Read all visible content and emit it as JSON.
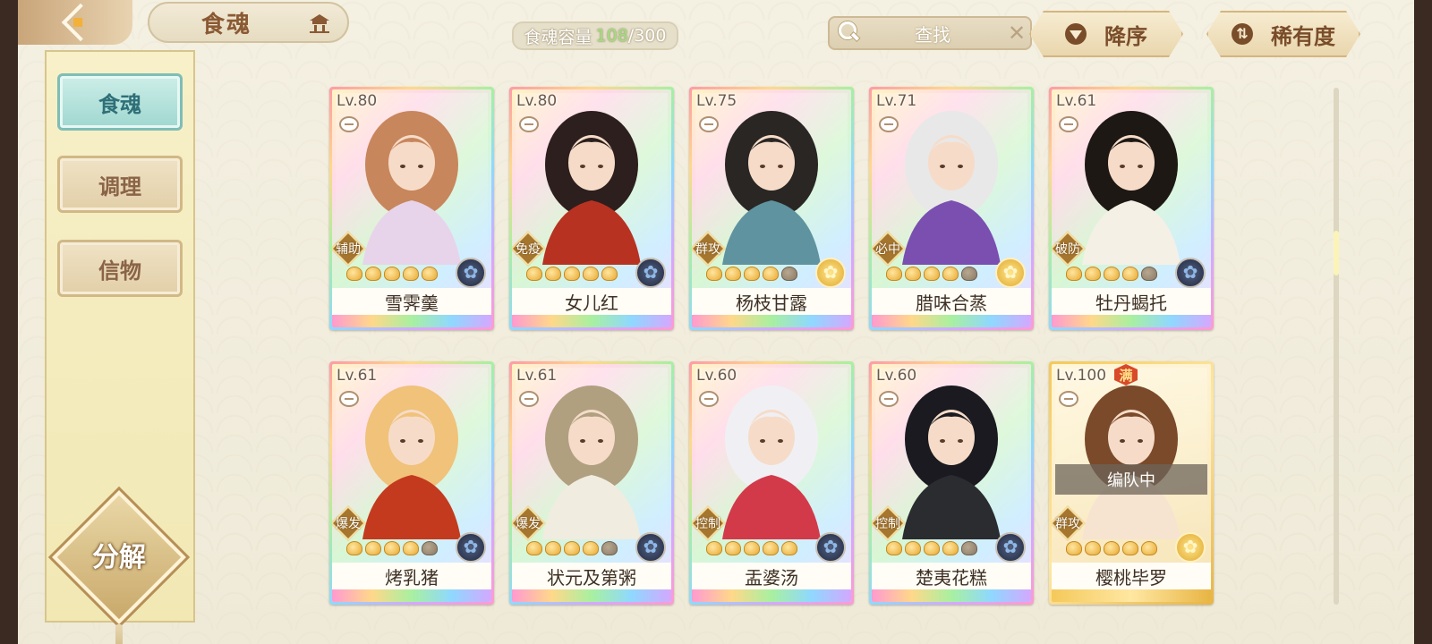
{
  "header": {
    "title": "食魂",
    "capacity_label": "食魂容量",
    "capacity_current": "108",
    "capacity_total": "/300",
    "search_placeholder": "查找",
    "search_clear": "✕",
    "sort_order": "降序",
    "sort_by": "稀有度"
  },
  "sidebar": {
    "items": [
      {
        "label": "食魂",
        "active": true
      },
      {
        "label": "调理",
        "active": false
      },
      {
        "label": "信物",
        "active": false
      }
    ],
    "decompose": "分解"
  },
  "cards": [
    {
      "level": "Lv.80",
      "role": "辅助",
      "name": "雪霁羹",
      "stars": 5,
      "element": "dark",
      "hair": "#c8865c",
      "robe": "#e7d4ea"
    },
    {
      "level": "Lv.80",
      "role": "免疫",
      "name": "女儿红",
      "stars": 5,
      "element": "dark",
      "hair": "#2c1f1d",
      "robe": "#b83222"
    },
    {
      "level": "Lv.75",
      "role": "群攻",
      "name": "杨枝甘露",
      "stars": 4,
      "element": "gold",
      "hair": "#2a2624",
      "robe": "#5f93a0"
    },
    {
      "level": "Lv.71",
      "role": "必中",
      "name": "腊味合蒸",
      "stars": 4,
      "element": "gold",
      "hair": "#e8e8e8",
      "robe": "#7a4fb0"
    },
    {
      "level": "Lv.61",
      "role": "破防",
      "name": "牡丹蝎托",
      "stars": 4,
      "element": "dark",
      "hair": "#1e1814",
      "robe": "#f4f0e6"
    },
    {
      "level": "Lv.61",
      "role": "爆发",
      "name": "烤乳猪",
      "stars": 4,
      "element": "dark",
      "hair": "#f0c27a",
      "robe": "#c43a1e"
    },
    {
      "level": "Lv.61",
      "role": "爆发",
      "name": "状元及第粥",
      "stars": 4,
      "element": "dark",
      "hair": "#b0a080",
      "robe": "#f0ece0"
    },
    {
      "level": "Lv.60",
      "role": "控制",
      "name": "盂婆汤",
      "stars": 5,
      "element": "dark",
      "hair": "#f0f0f4",
      "robe": "#d23a4a"
    },
    {
      "level": "Lv.60",
      "role": "控制",
      "name": "楚夷花糕",
      "stars": 4,
      "element": "dark",
      "hair": "#1a1a20",
      "robe": "#2a2c30"
    },
    {
      "level": "Lv.100",
      "role": "群攻",
      "name": "樱桃毕罗",
      "stars": 5,
      "element": "gold",
      "hair": "#7a4a2a",
      "robe": "#f6e4d0",
      "badge": "满",
      "status": "编队中"
    }
  ]
}
